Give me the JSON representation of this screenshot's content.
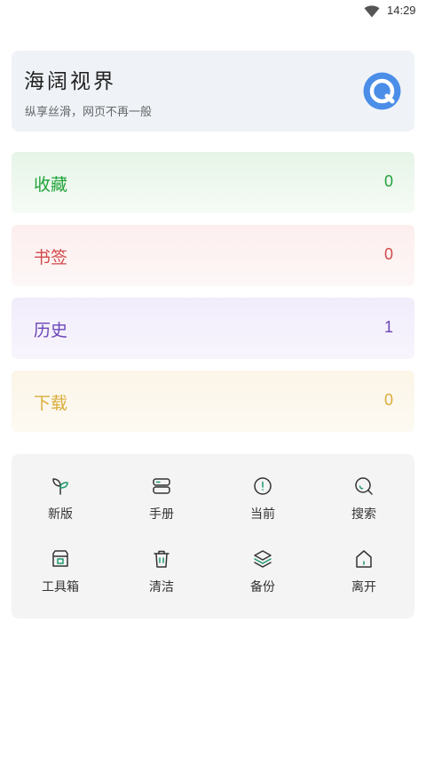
{
  "status_bar": {
    "time": "14:29",
    "wifi_icon": "wifi-icon"
  },
  "header": {
    "title": "海阔视界",
    "subtitle": "纵享丝滑，网页不再一般",
    "logo_icon": "app-logo-icon",
    "accent_color": "#4a8ee8"
  },
  "stats": [
    {
      "label": "收藏",
      "count": "0",
      "color": "#22a33a"
    },
    {
      "label": "书签",
      "count": "0",
      "color": "#d24a4a"
    },
    {
      "label": "历史",
      "count": "1",
      "color": "#6b46b8"
    },
    {
      "label": "下载",
      "count": "0",
      "color": "#d9ad3a"
    }
  ],
  "tools": [
    {
      "label": "新版",
      "icon": "sprout-icon"
    },
    {
      "label": "手册",
      "icon": "manual-icon"
    },
    {
      "label": "当前",
      "icon": "info-circle-icon"
    },
    {
      "label": "搜索",
      "icon": "search-icon"
    },
    {
      "label": "工具箱",
      "icon": "toolbox-icon"
    },
    {
      "label": "清洁",
      "icon": "trash-icon"
    },
    {
      "label": "备份",
      "icon": "layers-icon"
    },
    {
      "label": "离开",
      "icon": "home-icon"
    }
  ]
}
